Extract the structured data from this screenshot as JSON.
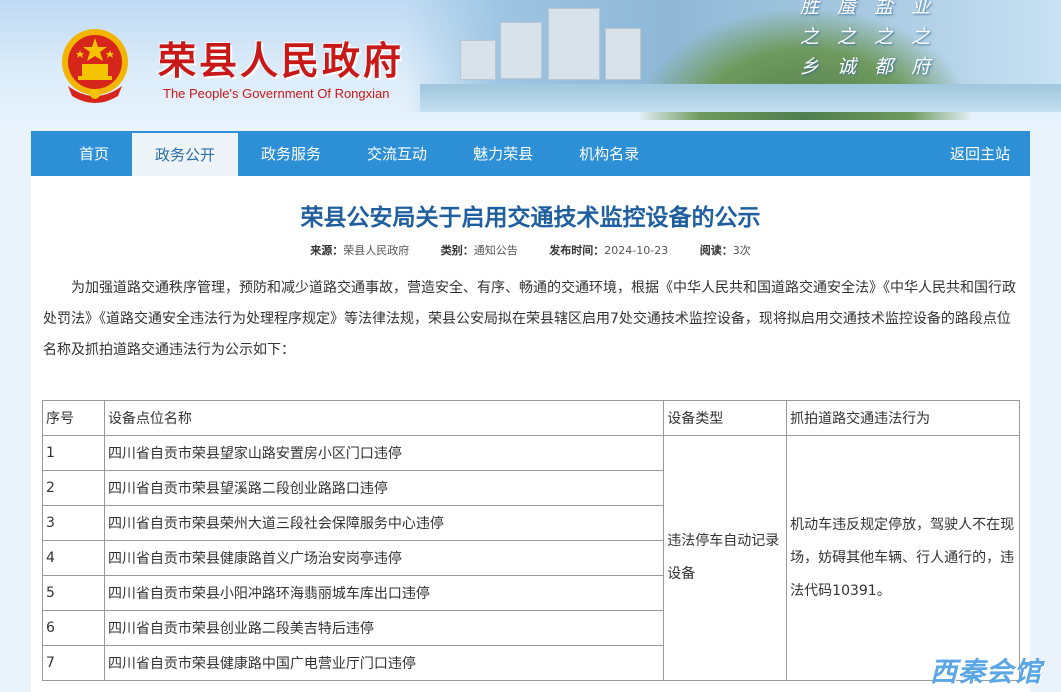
{
  "header": {
    "site_title": "荣县人民政府",
    "site_subtitle": "The People's Government Of Rongxian",
    "slogan_lines": [
      "胜 蜃 盐 业",
      "之 之 之 之",
      "乡 诚 都 府"
    ]
  },
  "nav": {
    "items": [
      {
        "label": "首页"
      },
      {
        "label": "政务公开",
        "active": true
      },
      {
        "label": "政务服务"
      },
      {
        "label": "交流互动"
      },
      {
        "label": "魅力荣县"
      },
      {
        "label": "机构名录"
      }
    ],
    "back_label": "返回主站"
  },
  "article": {
    "title": "荣县公安局关于启用交通技术监控设备的公示",
    "meta": {
      "source_key": "来源：",
      "source_val": "荣县人民政府",
      "category_key": "类别：",
      "category_val": "通知公告",
      "date_key": "发布时间：",
      "date_val": "2024-10-23",
      "views_key": "阅读：",
      "views_val": "3次"
    },
    "intro": "为加强道路交通秩序管理，预防和减少道路交通事故，营造安全、有序、畅通的交通环境，根据《中华人民共和国道路交通安全法》《中华人民共和国行政处罚法》《道路交通安全违法行为处理程序规定》等法律法规，荣县公安局拟在荣县辖区启用7处交通技术监控设备，现将拟启用交通技术监控设备的路段点位名称及抓拍道路交通违法行为公示如下："
  },
  "table": {
    "headers": [
      "序号",
      "设备点位名称",
      "设备类型",
      "抓拍道路交通违法行为"
    ],
    "rows": [
      {
        "no": "1",
        "name": "四川省自贡市荣县望家山路安置房小区门口违停"
      },
      {
        "no": "2",
        "name": "四川省自贡市荣县望溪路二段创业路路口违停"
      },
      {
        "no": "3",
        "name": "四川省自贡市荣县荣州大道三段社会保障服务中心违停"
      },
      {
        "no": "4",
        "name": "四川省自贡市荣县健康路首义广场治安岗亭违停"
      },
      {
        "no": "5",
        "name": "四川省自贡市荣县小阳冲路环海翡丽城车库出口违停"
      },
      {
        "no": "6",
        "name": "四川省自贡市荣县创业路二段美吉特后违停"
      },
      {
        "no": "7",
        "name": "四川省自贡市荣县健康路中国广电营业厅门口违停"
      }
    ],
    "device_type": "违法停车自动记录设备",
    "violation": "机动车违反规定停放，驾驶人不在现场，妨碍其他车辆、行人通行的，违法代码10391。"
  },
  "watermark": "西秦会馆",
  "colors": {
    "nav": "#2d8fd6",
    "title": "#1f5fa0",
    "site_title": "#c81818"
  }
}
